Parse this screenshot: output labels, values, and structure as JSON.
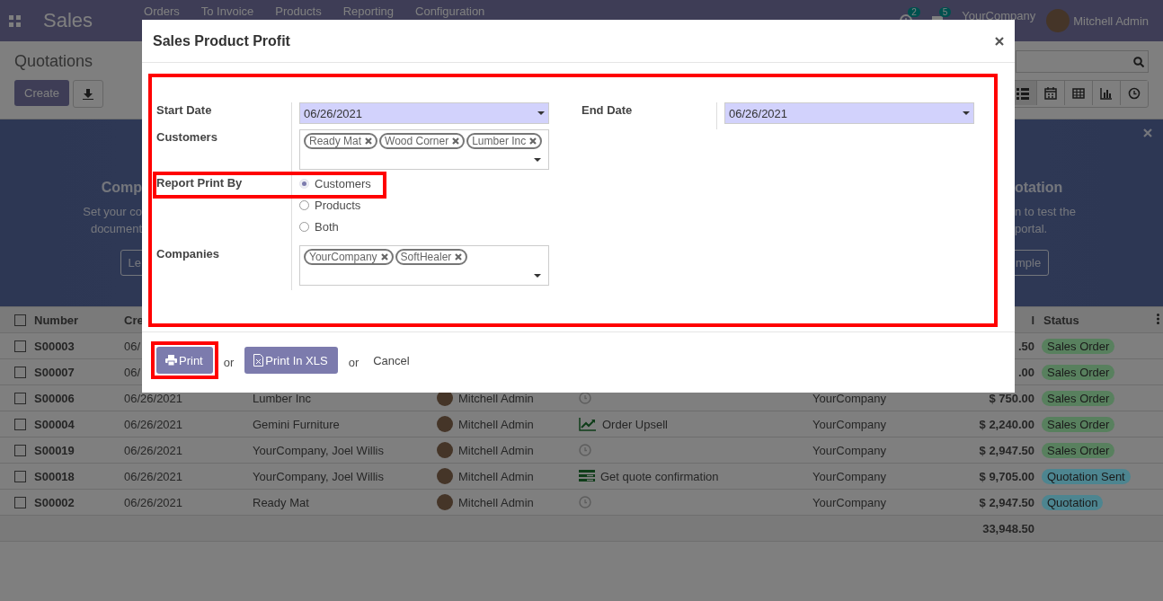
{
  "app_bar": {
    "app_name": "Sales",
    "menu": [
      "Orders",
      "To Invoice",
      "Products",
      "Reporting",
      "Configuration"
    ],
    "activity_count": "2",
    "message_count": "5",
    "company": "YourCompany",
    "user": "Mitchell Admin"
  },
  "control_panel": {
    "title": "Quotations",
    "create_button": "Create",
    "views": [
      {
        "kind": "list",
        "selected": true
      },
      {
        "kind": "calendar",
        "selected": false
      },
      {
        "kind": "pivot",
        "selected": false
      },
      {
        "kind": "graph",
        "selected": false
      },
      {
        "kind": "activity",
        "selected": false
      }
    ]
  },
  "banner": {
    "left_title": "Comp",
    "left_lines": [
      "Set your co",
      "document"
    ],
    "left_button": "Le",
    "right_title": "otation",
    "right_lines": [
      "n to test the",
      "portal."
    ],
    "right_button": "mple"
  },
  "table": {
    "all_checked": false,
    "columns": [
      "Number",
      "Cre",
      "l",
      "Status"
    ],
    "rows": [
      {
        "checked": false,
        "number": "S00003",
        "date": "06/",
        "total": ".50",
        "status": "Sales Order",
        "color": "#58805e"
      },
      {
        "checked": false,
        "number": "S00007",
        "date": "06/",
        "total": ".00",
        "status": "Sales Order",
        "color": "#58805e"
      },
      {
        "checked": false,
        "number": "S00006",
        "date": "06/26/2021",
        "customer": "Lumber Inc",
        "salesperson": "Mitchell Admin",
        "activity": {
          "kind": "none"
        },
        "company": "YourCompany",
        "total": "$ 750.00",
        "status": "Sales Order",
        "color": "#58805e"
      },
      {
        "checked": false,
        "number": "S00004",
        "date": "06/26/2021",
        "customer": "Gemini Furniture",
        "salesperson": "Mitchell Admin",
        "activity": {
          "kind": "upsell",
          "text": "Order Upsell"
        },
        "company": "YourCompany",
        "total": "$ 2,240.00",
        "status": "Sales Order",
        "color": "#58805e"
      },
      {
        "checked": false,
        "number": "S00019",
        "date": "06/26/2021",
        "customer": "YourCompany, Joel Willis",
        "salesperson": "Mitchell Admin",
        "activity": {
          "kind": "none"
        },
        "company": "YourCompany",
        "total": "$ 2,947.50",
        "status": "Sales Order",
        "color": "#58805e"
      },
      {
        "checked": false,
        "number": "S00018",
        "date": "06/26/2021",
        "customer": "YourCompany, Joel Willis",
        "salesperson": "Mitchell Admin",
        "activity": {
          "kind": "todo",
          "text": "Get quote confirmation"
        },
        "company": "YourCompany",
        "total": "$ 9,705.00",
        "status": "Quotation Sent",
        "color": "#4d8590"
      },
      {
        "checked": false,
        "number": "S00002",
        "date": "06/26/2021",
        "customer": "Ready Mat",
        "salesperson": "Mitchell Admin",
        "activity": {
          "kind": "none"
        },
        "company": "YourCompany",
        "total": "$ 2,947.50",
        "status": "Quotation",
        "color": "#4d8590"
      }
    ],
    "grand_total": "33,948.50"
  },
  "dialog": {
    "title": "Sales Product Profit",
    "highlighted": true,
    "start_date": {
      "label": "Start Date",
      "value": "06/26/2021"
    },
    "end_date": {
      "label": "End Date",
      "value": "06/26/2021"
    },
    "customers": {
      "label": "Customers",
      "tags": [
        "Ready Mat",
        "Wood Corner",
        "Lumber Inc"
      ]
    },
    "report_print_by": {
      "label": "Report Print By",
      "highlighted": true,
      "options": [
        {
          "label": "Customers",
          "selected": true
        },
        {
          "label": "Products",
          "selected": false
        },
        {
          "label": "Both",
          "selected": false
        }
      ]
    },
    "companies": {
      "label": "Companies",
      "tags": [
        "YourCompany",
        "SoftHealer"
      ]
    },
    "footer": [
      {
        "kind": "print",
        "label": "Print",
        "highlighted": true
      },
      {
        "kind": "separator",
        "label": "or"
      },
      {
        "kind": "export",
        "label": "Print In XLS",
        "highlighted": false
      },
      {
        "kind": "separator",
        "label": "or"
      },
      {
        "kind": "link",
        "label": "Cancel"
      }
    ]
  }
}
